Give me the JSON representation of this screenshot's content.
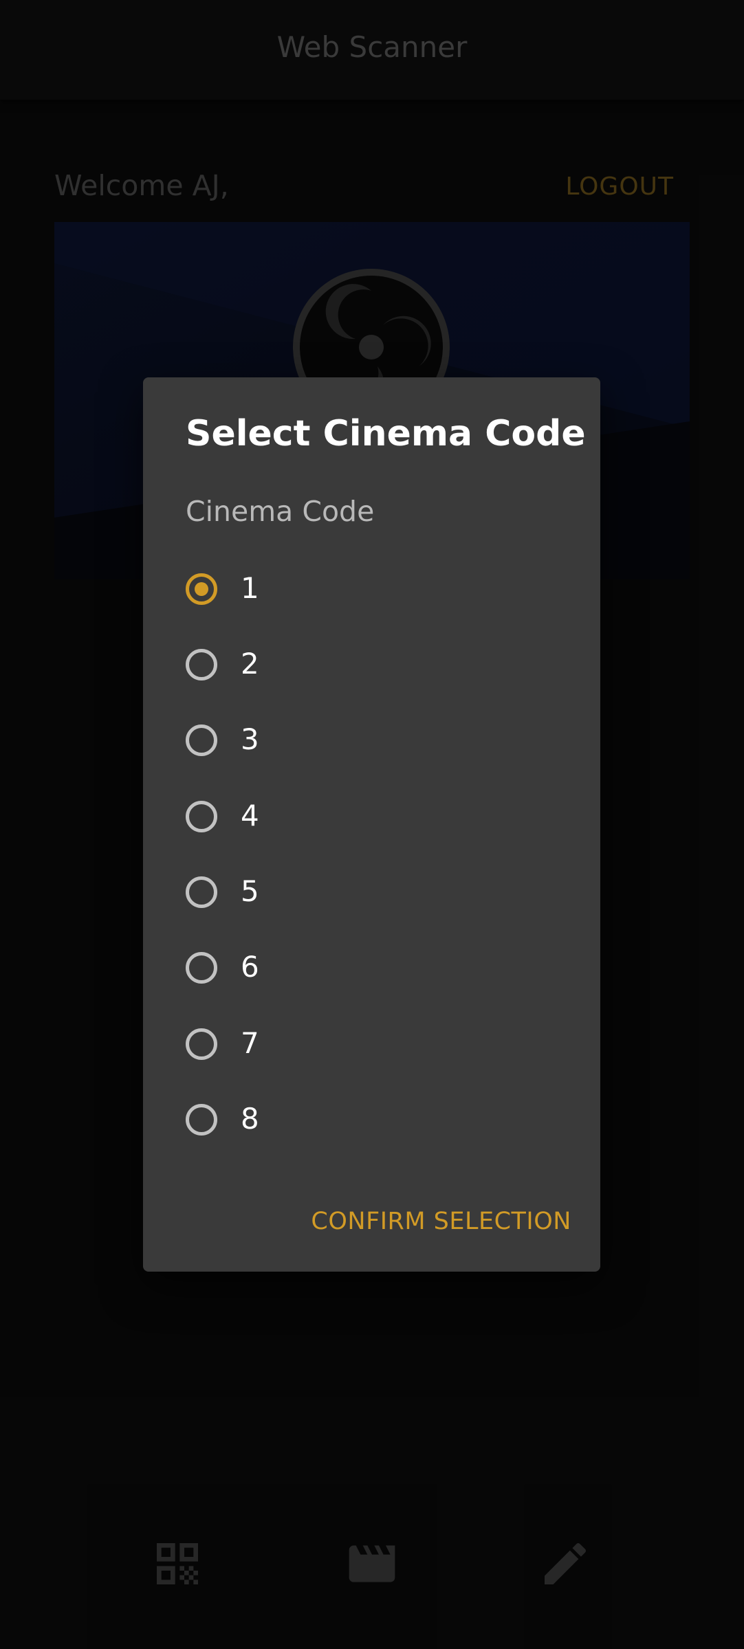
{
  "header": {
    "title": "Web Scanner"
  },
  "home": {
    "welcome": "Welcome AJ,",
    "logout_label": "LOGOUT"
  },
  "dialog": {
    "title": "Select Cinema Code",
    "group_label": "Cinema Code",
    "options": [
      {
        "label": "1",
        "selected": true
      },
      {
        "label": "2",
        "selected": false
      },
      {
        "label": "3",
        "selected": false
      },
      {
        "label": "4",
        "selected": false
      },
      {
        "label": "5",
        "selected": false
      },
      {
        "label": "6",
        "selected": false
      },
      {
        "label": "7",
        "selected": false
      },
      {
        "label": "8",
        "selected": false
      }
    ],
    "confirm_label": "CONFIRM SELECTION"
  },
  "bottom_nav": {
    "items": [
      {
        "icon": "qr-code-icon"
      },
      {
        "icon": "clapperboard-icon"
      },
      {
        "icon": "pencil-icon"
      }
    ]
  },
  "colors": {
    "accent": "#d29b26",
    "dialog_bg": "#3a3a3a",
    "background": "#0a0a0a"
  }
}
